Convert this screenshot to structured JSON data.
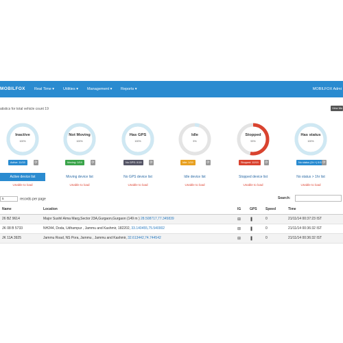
{
  "header": {
    "brand": "MOBILFOX",
    "menu": [
      "Real Time ▾",
      "Utilities ▾",
      "Management ▾",
      "Reports ▾"
    ],
    "user": "MOBILFOX Admi"
  },
  "subheading": "atistics for total vehicle count 19",
  "view_more_label": "View Mo",
  "cards": [
    {
      "label": "Inactive",
      "pct": "100%",
      "badge": "Active: 11/19",
      "badge_color": "#2a8bd0",
      "ring_color": "#cfe8f3",
      "progress": 1.0,
      "list": "Active device list",
      "active": true,
      "error": "Unable to load"
    },
    {
      "label": "Not Moving",
      "pct": "100%",
      "badge": "Moving: 0/19",
      "badge_color": "#3aa44a",
      "ring_color": "#cfe8f3",
      "progress": 1.0,
      "list": "Moving device list",
      "active": false,
      "error": "Unable to load"
    },
    {
      "label": "Has GPS",
      "pct": "100%",
      "badge": "No GPS: 0/19",
      "badge_color": "#556",
      "ring_color": "#cfe8f3",
      "progress": 1.0,
      "list": "No GPS device list",
      "active": false,
      "error": "Unable to load"
    },
    {
      "label": "Idle",
      "pct": "5%",
      "badge": "Idle: 1/19",
      "badge_color": "#e8a020",
      "ring_color": "#cfe8f3",
      "progress": 0.05,
      "list": "Idle device list",
      "active": false,
      "error": "Unable to load"
    },
    {
      "label": "Stopped",
      "pct": "53%",
      "badge": "Stopped: 10/19",
      "badge_color": "#d9432f",
      "ring_color": "#d9432f",
      "progress": 0.53,
      "list": "Stopped device list",
      "active": false,
      "error": "Unable to load"
    },
    {
      "label": "Has status",
      "pct": "100%",
      "badge": "No status (1h +) 0/19",
      "badge_color": "#2a8bd0",
      "ring_color": "#cfe8f3",
      "progress": 1.0,
      "list": "No status > 1hr list",
      "active": false,
      "error": "Unable to load"
    }
  ],
  "records_select": "5",
  "records_label": "records per page",
  "search_label": "Search:",
  "table": {
    "headers": [
      "Name",
      "Location",
      "IG",
      "GPS",
      "Speed",
      "Time"
    ],
    "rows": [
      {
        "name": "26 BZ 9614",
        "location": "Major Sushil Aima Marg,Sector 23A,Gurgaon,Gurgaon (149 m )",
        "coords": "28.508717,77.345839",
        "ig": "⊞",
        "gps": "❚",
        "speed": "0",
        "time": "21/11/14 00:37:23 IST"
      },
      {
        "name": "JK 08 B 5733",
        "location": "NH244, Doda, Udhampur , Jammu and Kashmir, 182202,",
        "coords": "33.140455,75.540002",
        "ig": "⊞",
        "gps": "❚",
        "speed": "0",
        "time": "21/11/14 00:36:32 IST"
      },
      {
        "name": "JK 11A 3925",
        "location": "Jammu Road, NS Pora, Jammu , Jammu and Kashmir,",
        "coords": "32.613442,74.744542",
        "ig": "⊞",
        "gps": "❚",
        "speed": "0",
        "time": "21/11/14 00:36:32 IST"
      }
    ]
  }
}
